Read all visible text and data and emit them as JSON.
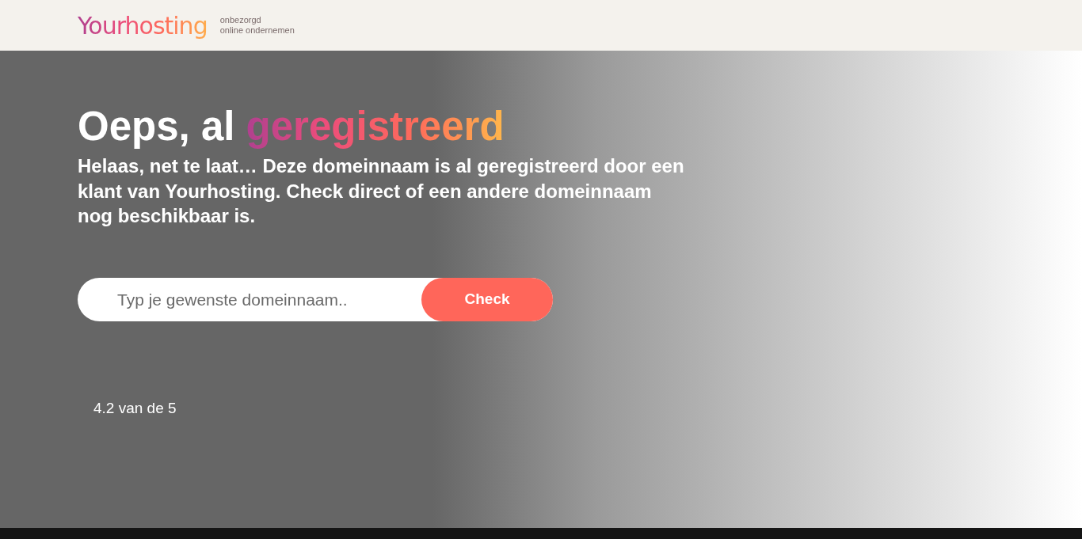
{
  "header": {
    "logo": "Yourhosting",
    "tagline": [
      "onbezorgd",
      "online ondernemen"
    ]
  },
  "hero": {
    "heading": "Oeps, al",
    "heading_highlight": "geregistreerd",
    "text": "Helaas, net te laat… Deze domeinnaam is al geregistreerd door een klant van Yourhosting. Check direct of een andere domeinnaam nog beschikbaar is.",
    "search": {
      "placeholder": "Typ je gewenste domeinnaam..",
      "button": "Check"
    },
    "rating": "4.2 van de 5"
  }
}
